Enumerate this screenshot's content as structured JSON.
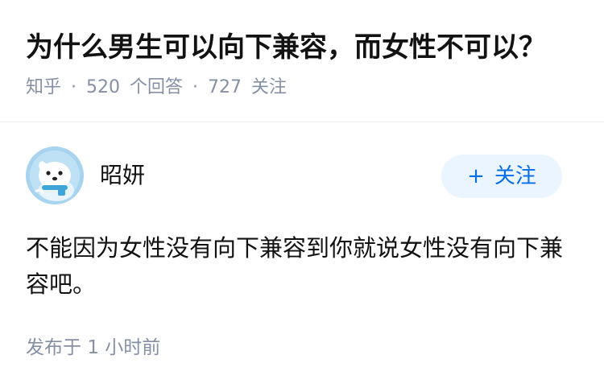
{
  "question": {
    "title": "为什么男生可以向下兼容，而女性不可以？",
    "source": "知乎",
    "separator": "·",
    "answers_count": "520",
    "answers_label": "个回答",
    "followers_count": "727",
    "followers_label": "关注"
  },
  "answer": {
    "author_name": "昭妍",
    "avatar_icon": "seal-avatar-icon",
    "follow_plus": "+",
    "follow_label": "关注",
    "content": "不能因为女性没有向下兼容到你就说女性没有向下兼容吧。",
    "time_prefix": "发布于",
    "time_value": "1 小时前"
  },
  "colors": {
    "meta_gray": "#8590a6",
    "accent_blue": "#056de8",
    "follow_bg": "#ebf5ff",
    "avatar_bg": "#a8d4ef"
  }
}
